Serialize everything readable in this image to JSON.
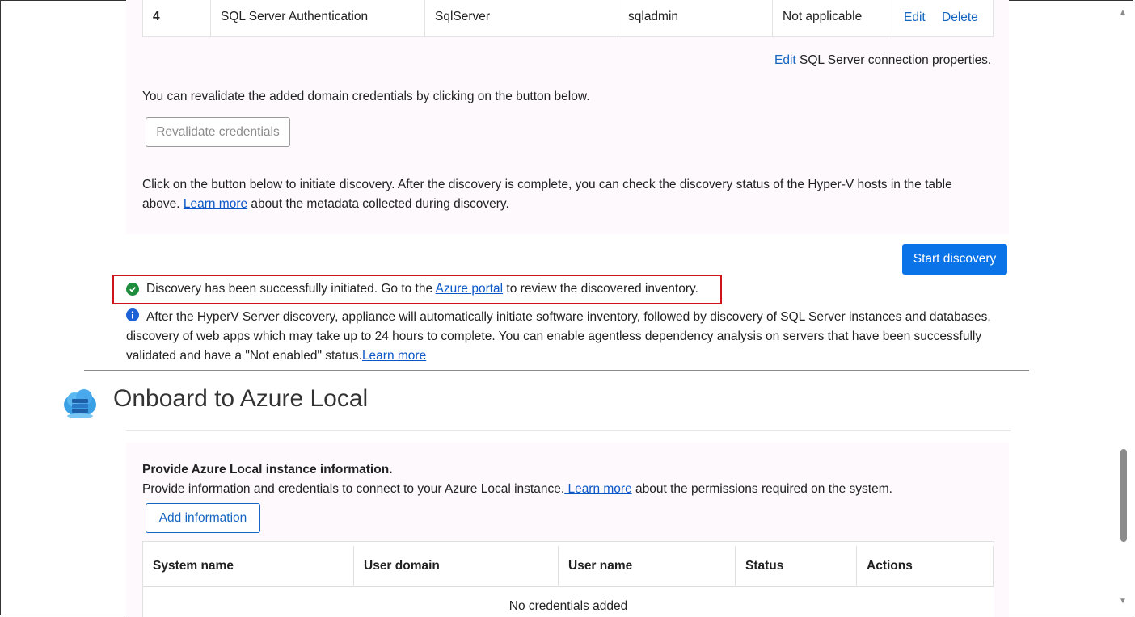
{
  "credentials_row": {
    "index": "4",
    "type": "SQL Server Authentication",
    "friendly_name": "SqlServer",
    "username": "sqladmin",
    "status": "Not applicable",
    "edit": "Edit",
    "delete": "Delete"
  },
  "edit_sql": {
    "link": "Edit",
    "text": " SQL Server connection properties."
  },
  "revalidate": {
    "text": "You can revalidate the added domain credentials by clicking on the button below.",
    "button": "Revalidate credentials"
  },
  "discovery": {
    "intro_line1": "Click on the button below to initiate discovery. After the discovery is complete, you can check the discovery status of the Hyper-V hosts in the table",
    "intro_line2_prefix": "above. ",
    "learn_more": "Learn more",
    "intro_line2_suffix": " about the metadata collected during discovery.",
    "start_button": "Start discovery",
    "success_prefix": "Discovery has been successfully initiated. Go to the ",
    "success_link": "Azure portal",
    "success_suffix": " to review the discovered inventory.",
    "info_line1": "After the HyperV Server discovery, appliance will automatically initiate software inventory, followed by discovery of SQL Server instances and databases,",
    "info_line2": "discovery of web apps which may take up to 24 hours to complete. You can enable agentless dependency analysis on servers that have been successfully",
    "info_line3": "validated and have a \"Not enabled\" status.",
    "info_learn_more": "Learn more"
  },
  "onboard": {
    "title": "Onboard to Azure Local",
    "heading": "Provide Azure Local instance information.",
    "desc_prefix": "Provide information and credentials to connect to your Azure Local instance.",
    "desc_link": " Learn more",
    "desc_suffix": " about the permissions required on the system.",
    "add_button": "Add information",
    "table_headers": [
      "System name",
      "User domain",
      "User name",
      "Status",
      "Actions"
    ],
    "empty_text": "No credentials added"
  },
  "colors": {
    "success": "#1e8e3e",
    "info": "#1a62d6",
    "primary": "#0a73e8",
    "highlight_border": "#d0121b"
  },
  "icons": [
    "check-circle-icon",
    "info-icon",
    "azure-local-cloud-icon",
    "scroll-up-icon",
    "scroll-down-icon"
  ]
}
